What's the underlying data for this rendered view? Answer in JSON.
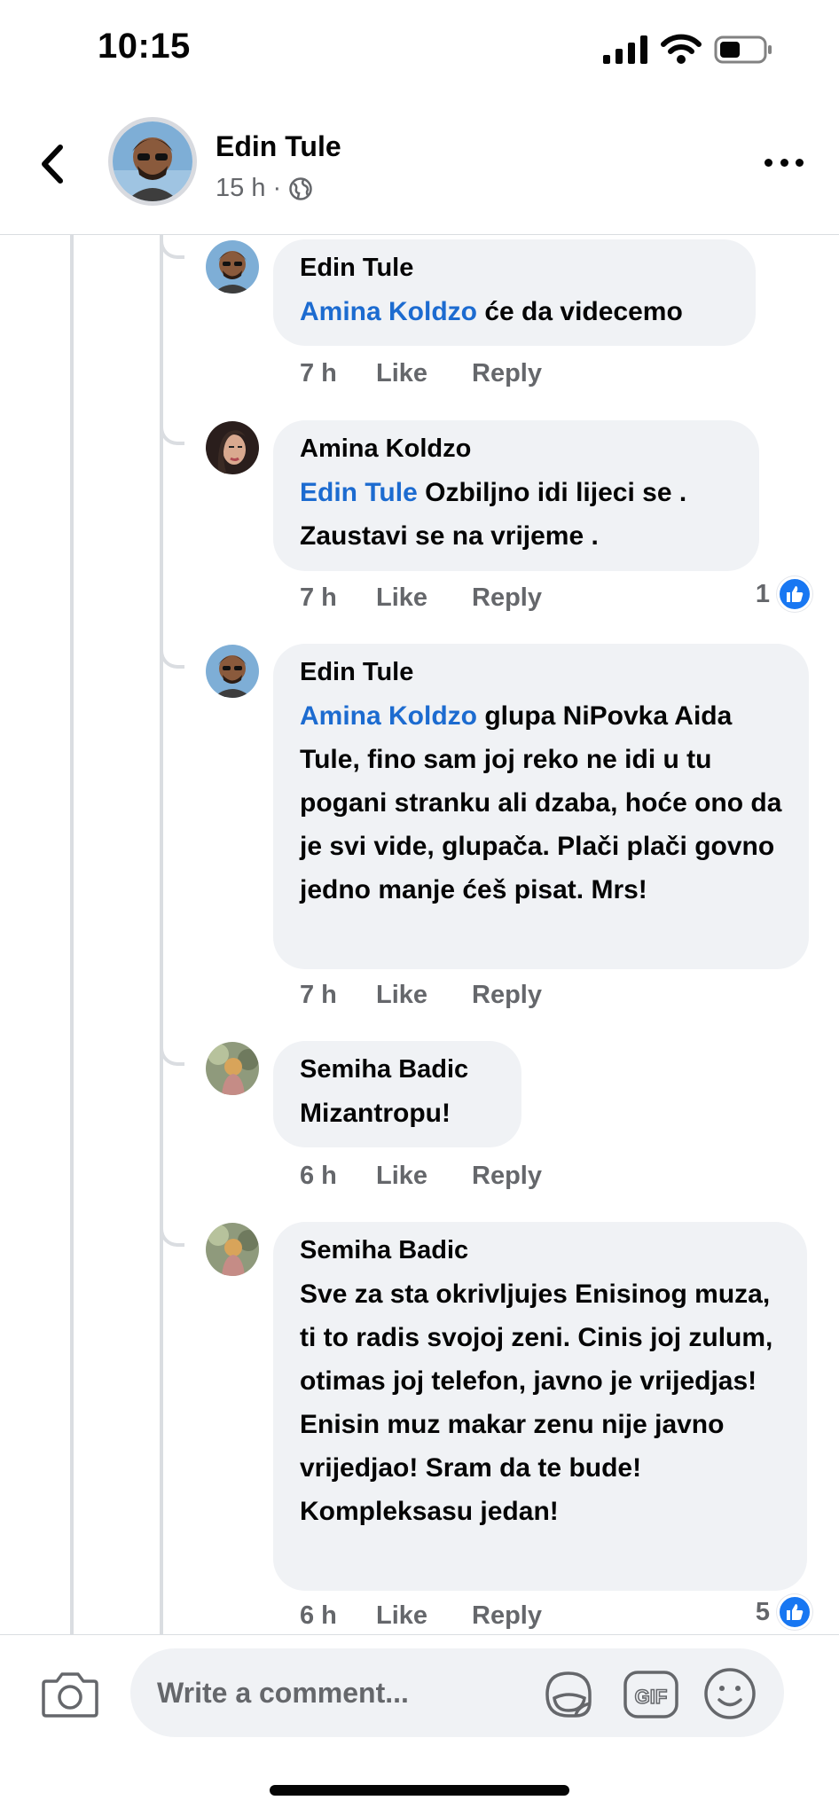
{
  "status_bar": {
    "time": "10:15"
  },
  "header": {
    "name": "Edin Tule",
    "time": "15 h",
    "separator": "·"
  },
  "comments": [
    {
      "author": "Edin Tule",
      "mention": "Amina Koldzo",
      "text": " će da videcemo",
      "time": "7 h",
      "like_label": "Like",
      "reply_label": "Reply",
      "reactions": ""
    },
    {
      "author": "Amina Koldzo",
      "mention": "Edin Tule",
      "text": " Ozbiljno idi lijeci se . Zaustavi se na vrijeme .",
      "time": "7 h",
      "like_label": "Like",
      "reply_label": "Reply",
      "reactions": "1"
    },
    {
      "author": "Edin Tule",
      "mention": "Amina Koldzo",
      "text": " glupa NiPovka Aida Tule, fino sam joj reko ne idi u tu pogani stranku ali dzaba, hoće ono da je svi vide, glupača. Plači plači govno jedno manje ćeš pisat. Mrs!",
      "time": "7 h",
      "like_label": "Like",
      "reply_label": "Reply",
      "reactions": ""
    },
    {
      "author": "Semiha Badic",
      "mention": "",
      "text": "Mizantropu!",
      "time": "6 h",
      "like_label": "Like",
      "reply_label": "Reply",
      "reactions": ""
    },
    {
      "author": "Semiha Badic",
      "mention": "",
      "text": "Sve za sta okrivljujes Enisinog muza, ti to radis svojoj zeni. Cinis joj zulum, otimas joj telefon, javno je vrijedjas! Enisin muz makar zenu nije javno vrijedjao! Sram da te bude! Kompleksasu jedan!",
      "time": "6 h",
      "like_label": "Like",
      "reply_label": "Reply",
      "reactions": "5"
    }
  ],
  "composer": {
    "placeholder": "Write a comment...",
    "gif_label": "GIF"
  },
  "colors": {
    "mention": "#1c6bd0",
    "bubble": "#f0f2f5",
    "meta": "#65676b",
    "like_blue": "#1877f2"
  }
}
